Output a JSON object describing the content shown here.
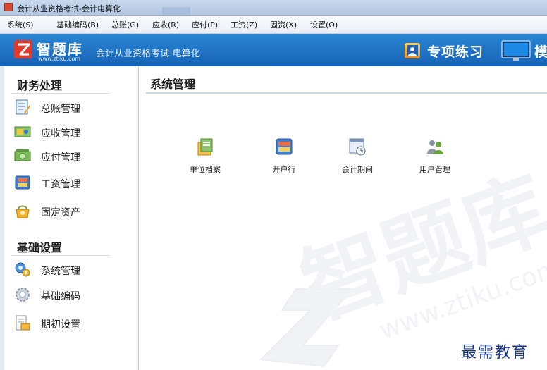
{
  "window": {
    "title": "会计从业资格考试-会计电算化"
  },
  "menu": [
    "系统(S)",
    "基础编码(B)",
    "总账(G)",
    "应收(R)",
    "应付(P)",
    "工资(Z)",
    "固资(X)",
    "设置(O)"
  ],
  "banner": {
    "brand_name": "智题库",
    "brand_url": "www.ztiku.com",
    "subtitle": "会计从业资格考试-电算化",
    "practice_label": "专项练习",
    "mock_label": "模"
  },
  "sidebar": {
    "sections": [
      {
        "title": "财务处理",
        "items": [
          {
            "label": "总账管理",
            "icon": "ledger-icon"
          },
          {
            "label": "应收管理",
            "icon": "receivable-icon"
          },
          {
            "label": "应付管理",
            "icon": "payable-icon"
          },
          {
            "label": "工资管理",
            "icon": "payroll-icon"
          },
          {
            "label": "固定资产",
            "icon": "fixed-asset-icon"
          }
        ]
      },
      {
        "title": "基础设置",
        "items": [
          {
            "label": "系统管理",
            "icon": "system-gears-icon"
          },
          {
            "label": "基础编码",
            "icon": "gear-icon"
          },
          {
            "label": "期初设置",
            "icon": "opening-balance-icon"
          }
        ]
      }
    ]
  },
  "main": {
    "title": "系统管理",
    "tools": [
      {
        "label": "单位档案",
        "icon": "company-file-icon"
      },
      {
        "label": "开户行",
        "icon": "bank-card-icon"
      },
      {
        "label": "会计期间",
        "icon": "calendar-clock-icon"
      },
      {
        "label": "用户管理",
        "icon": "users-icon"
      }
    ]
  },
  "watermark": {
    "text": "智题库 www.ztiku.com"
  },
  "corner_text": "最需教育",
  "colors": {
    "banner": "#1f74c8",
    "section_title": "#1a1a1a",
    "corner_text": "#1e3a8a"
  }
}
